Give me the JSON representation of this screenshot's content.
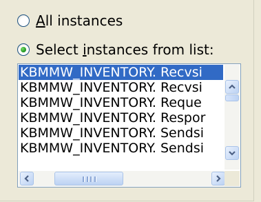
{
  "options": {
    "all_instances": {
      "mnemonic": "A",
      "rest": "ll instances",
      "selected": false
    },
    "select_from_list": {
      "before": "Select ",
      "mnemonic": "i",
      "after": "nstances from list:",
      "selected": true
    }
  },
  "list": {
    "items": [
      "KBMMW_INVENTORY. Recvsi",
      "KBMMW_INVENTORY. Recvsi",
      "KBMMW_INVENTORY. Reque",
      "KBMMW_INVENTORY. Respor",
      "KBMMW_INVENTORY. Sendsi",
      "KBMMW_INVENTORY. Sendsi"
    ],
    "selected_index": 0
  },
  "icons": {
    "scroll_up": "chevron-up-icon",
    "scroll_down": "chevron-down-icon",
    "scroll_left": "chevron-left-icon",
    "scroll_right": "chevron-right-icon"
  },
  "colors": {
    "selection": "#316ac5",
    "radio_dot": "#2aa02a",
    "background": "#ece9d8"
  }
}
